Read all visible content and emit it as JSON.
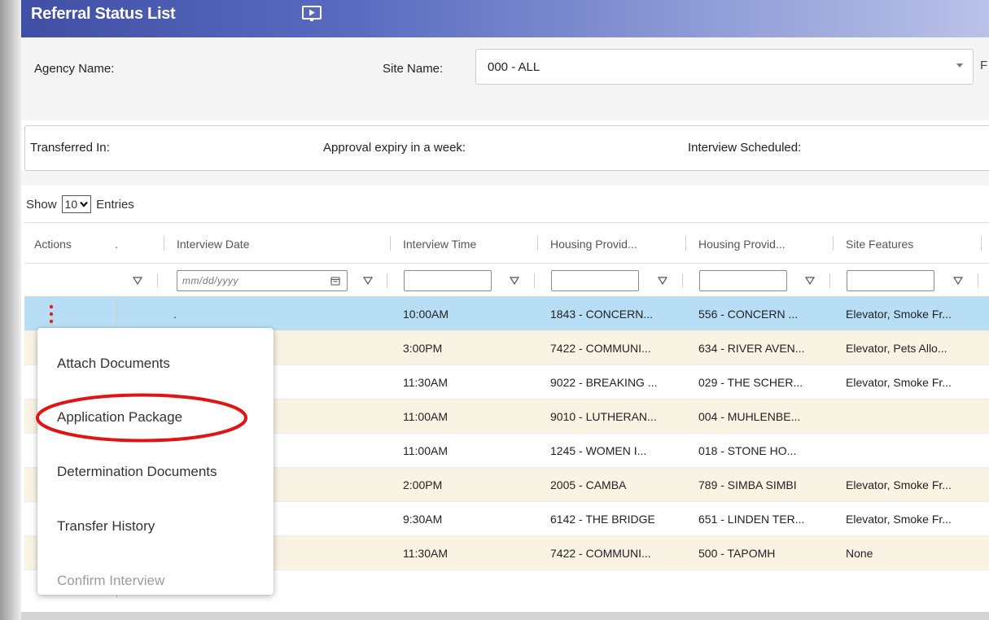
{
  "window": {
    "title": "Referral Status List",
    "title_icon": "presentation-icon"
  },
  "filters": {
    "agency_label": "Agency Name:",
    "agency_value": "",
    "site_label": "Site Name:",
    "site_value": "000 - ALL",
    "cut_label": "F"
  },
  "summary": {
    "transferred_in": "Transferred In:",
    "approval_expiry": "Approval expiry in a week:",
    "interview_scheduled": "Interview Scheduled:"
  },
  "entries": {
    "show_label": "Show",
    "page_size": "10",
    "entries_label": "Entries"
  },
  "grid": {
    "columns": [
      "Actions",
      ".",
      "Interview Date",
      "Interview Time",
      "Housing Provid...",
      "Housing Provid...",
      "Site Features"
    ],
    "date_placeholder": "mm/dd/yyyy",
    "rows": [
      {
        "date": ".",
        "time": "10:00AM",
        "provider": "1843 - CONCERN...",
        "site": "556 - CONCERN ...",
        "features": "Elevator, Smoke Fr..."
      },
      {
        "date": "",
        "time": "3:00PM",
        "provider": "7422 - COMMUNI...",
        "site": "634 - RIVER AVEN...",
        "features": "Elevator, Pets Allo..."
      },
      {
        "date": "",
        "time": "11:30AM",
        "provider": "9022 - BREAKING ...",
        "site": "029 - THE SCHER...",
        "features": "Elevator, Smoke Fr..."
      },
      {
        "date": "",
        "time": "11:00AM",
        "provider": "9010 - LUTHERAN...",
        "site": "004 - MUHLENBE...",
        "features": ""
      },
      {
        "date": "",
        "time": "11:00AM",
        "provider": "1245 - WOMEN I...",
        "site": "018 - STONE HO...",
        "features": ""
      },
      {
        "date": "",
        "time": "2:00PM",
        "provider": "2005 - CAMBA",
        "site": "789 - SIMBA SIMBI",
        "features": "Elevator, Smoke Fr..."
      },
      {
        "date": "",
        "time": "9:30AM",
        "provider": "6142 - THE BRIDGE",
        "site": "651 - LINDEN TER...",
        "features": "Elevator, Smoke Fr..."
      },
      {
        "date": "",
        "time": "11:30AM",
        "provider": "7422 - COMMUNI...",
        "site": "500 - TAPOMH",
        "features": "None"
      }
    ]
  },
  "menu": {
    "items": [
      {
        "label": "Attach Documents",
        "enabled": true
      },
      {
        "label": "Application Package",
        "enabled": true,
        "highlighted": true
      },
      {
        "label": "Determination Documents",
        "enabled": true
      },
      {
        "label": "Transfer History",
        "enabled": true
      },
      {
        "label": "Confirm Interview",
        "enabled": false
      }
    ]
  },
  "colors": {
    "title_bar_start": "#3f4fa6",
    "selected_row": "#b8def5",
    "alt_row": "#f8f3e3",
    "kebab": "#e0241b",
    "highlight_ring": "#e01414"
  }
}
